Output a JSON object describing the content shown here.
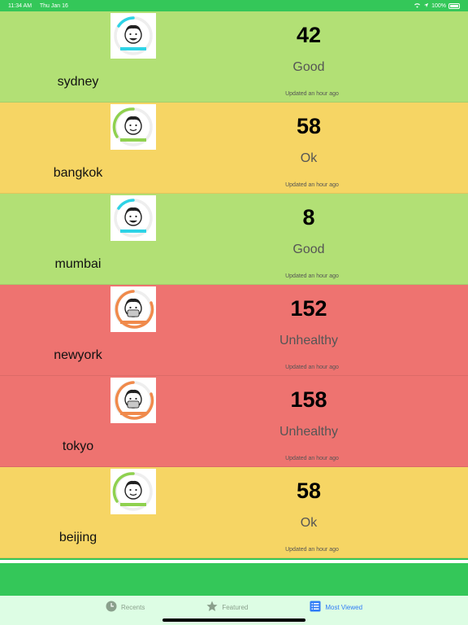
{
  "status_bar": {
    "time": "11:34 AM",
    "date": "Thu Jan 16",
    "battery": "100%"
  },
  "rows": [
    {
      "city": "sydney",
      "aqi": "42",
      "status": "Good",
      "updated": "Updated an hour ago",
      "level": "good"
    },
    {
      "city": "bangkok",
      "aqi": "58",
      "status": "Ok",
      "updated": "Updated an hour ago",
      "level": "ok"
    },
    {
      "city": "mumbai",
      "aqi": "8",
      "status": "Good",
      "updated": "Updated an hour ago",
      "level": "good"
    },
    {
      "city": "newyork",
      "aqi": "152",
      "status": "Unhealthy",
      "updated": "Updated an hour ago",
      "level": "unhealthy"
    },
    {
      "city": "tokyo",
      "aqi": "158",
      "status": "Unhealthy",
      "updated": "Updated an hour ago",
      "level": "unhealthy"
    },
    {
      "city": "beijing",
      "aqi": "58",
      "status": "Ok",
      "updated": "Updated an hour ago",
      "level": "ok"
    }
  ],
  "tabs": [
    {
      "label": "Recents",
      "icon": "clock-icon"
    },
    {
      "label": "Featured",
      "icon": "star-icon"
    },
    {
      "label": "Most Viewed",
      "icon": "list-icon",
      "active": true
    }
  ],
  "colors": {
    "good": "#b2e075",
    "ok": "#f6d564",
    "unhealthy": "#ee7370",
    "accent": "#2f7bf6",
    "tabbar": "#ddfde4",
    "header": "#34c759"
  }
}
